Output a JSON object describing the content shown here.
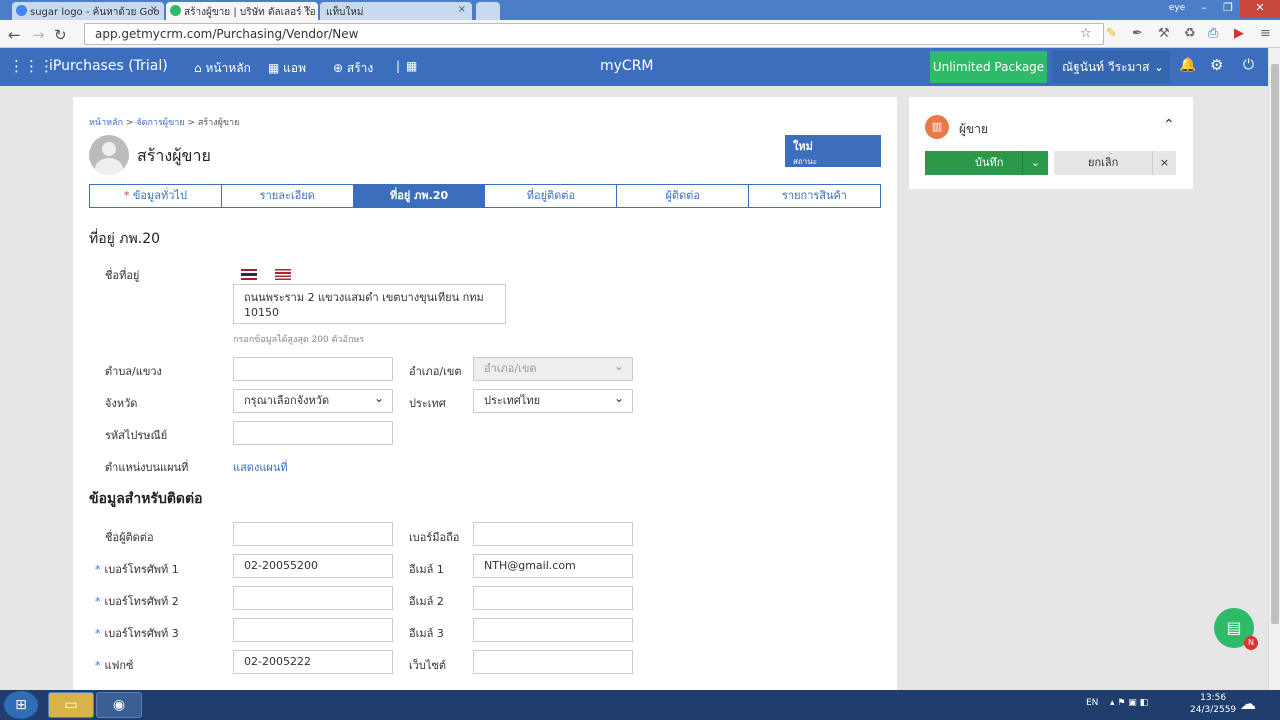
{
  "browser": {
    "tabs": [
      {
        "label": "sugar logo - ค้นหาด้วย Goo",
        "color": "#4285f4"
      },
      {
        "label": "สร้างผู้ขาย | บริษัท ดัลเลอร์ ไอ",
        "color": "#2dbb6a"
      },
      {
        "label": "แท็บใหม่",
        "color": ""
      }
    ],
    "tab_close": "×",
    "window_user": "eye",
    "url": "app.getmycrm.com/Purchasing/Vendor/New"
  },
  "header": {
    "app_name": "iPurchases (Trial)",
    "nav_home": "หน้าหลัก",
    "nav_apps": "แอพ",
    "nav_create": "สร้าง",
    "logo": "myCRM",
    "package": "Unlimited Package",
    "user": "ณัฐนันท์ วีระมาส"
  },
  "breadcrumb": {
    "home": "หน้าหลัก",
    "sep1": ">",
    "manage": "จัดการผู้ขาย",
    "sep2": ">",
    "current": "สร้างผู้ขาย"
  },
  "page_title": "สร้างผู้ขาย",
  "status": {
    "value": "ใหม่",
    "label": "สถานะ"
  },
  "tabs": [
    {
      "label": "ข้อมูลทั่วไป",
      "required": "*"
    },
    {
      "label": "รายละเอียด"
    },
    {
      "label": "ที่อยู่ ภพ.20"
    },
    {
      "label": "ที่อยู่ติดต่อ"
    },
    {
      "label": "ผู้ติดต่อ"
    },
    {
      "label": "รายการสินค้า"
    }
  ],
  "address": {
    "heading": "ที่อยู่ ภพ.20",
    "address_label": "ชื่อที่อยู่",
    "address_value": "ถนนพระราม 2 แขวงแสมดำ เขตบางขุนเทียน กทม 10150",
    "hint": "กรอกข้อมูลได้สูงสุด 200 ตัวอักษร",
    "subdistrict_label": "ตำบล/แขวง",
    "subdistrict_value": "",
    "district_label": "อำเภอ/เขต",
    "district_placeholder": "อำเภอ/เขต",
    "province_label": "จังหวัด",
    "province_value": "กรุณาเลือกจังหวัด",
    "country_label": "ประเทศ",
    "country_value": "ประเทศไทย",
    "postcode_label": "รหัสไปรษณีย์",
    "postcode_value": "",
    "map_label": "ตำแหน่งบนแผนที่",
    "map_link": "แสดงแผนที่"
  },
  "contact": {
    "heading": "ข้อมูลสำหรับติดต่อ",
    "required": "*",
    "contact_name_label": "ชื่อผู้ติดต่อ",
    "contact_name_value": "",
    "mobile_label": "เบอร์มือถือ",
    "mobile_value": "",
    "phone1_label": "เบอร์โทรศัพท์ 1",
    "phone1_value": "02-20055200",
    "email1_label": "อีเมล์ 1",
    "email1_value": "NTH@gmail.com",
    "phone2_label": "เบอร์โทรศัพท์ 2",
    "phone2_value": "",
    "email2_label": "อีเมล์ 2",
    "email2_value": "",
    "phone3_label": "เบอร์โทรศัพท์ 3",
    "phone3_value": "",
    "email3_label": "อีเมล์ 3",
    "email3_value": "",
    "fax_label": "แฟกซ์",
    "fax_value": "02-2005222",
    "website_label": "เว็บไซต์",
    "website_value": ""
  },
  "side": {
    "title": "ผู้ขาย",
    "save": "บันทึก",
    "cancel": "ยกเลิก"
  },
  "fab_badge": "N",
  "taskbar": {
    "lang": "EN",
    "time": "13:56",
    "date": "24/3/2559"
  },
  "colors": {
    "primary": "#3b6fbe",
    "green": "#2dbb6a",
    "save": "#2a9a4a"
  }
}
